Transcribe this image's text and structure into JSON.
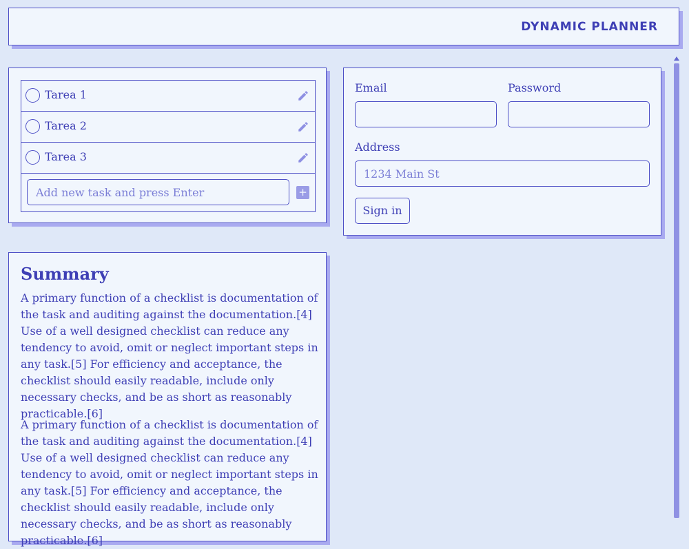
{
  "header": {
    "title": "DYNAMIC PLANNER"
  },
  "tasks": {
    "items": [
      {
        "label": "Tarea 1"
      },
      {
        "label": "Tarea 2"
      },
      {
        "label": "Tarea 3"
      }
    ],
    "new_task_placeholder": "Add new task and press Enter",
    "add_icon": "+"
  },
  "form": {
    "email_label": "Email",
    "email_value": "",
    "password_label": "Password",
    "password_value": "",
    "address_label": "Address",
    "address_placeholder": "1234 Main St",
    "address_value": "",
    "sign_in_label": "Sign in"
  },
  "summary": {
    "title": "Summary",
    "paragraphs": [
      "A primary function of a checklist is documentation of the task and auditing against the documentation.[4] Use of a well designed checklist can reduce any tendency to avoid, omit or neglect important steps in any task.[5] For efficiency and acceptance, the checklist should easily readable, include only necessary checks, and be as short as reasonably practicable.[6]",
      "A primary function of a checklist is documentation of the task and auditing against the documentation.[4] Use of a well designed checklist can reduce any tendency to avoid, omit or neglect important steps in any task.[5] For efficiency and acceptance, the checklist should easily readable, include only necessary checks, and be as short as reasonably practicable.[6]"
    ]
  },
  "colors": {
    "accent": "#3e3fb5",
    "card_bg": "#f1f6fd",
    "page_bg": "#dfe8f8",
    "shadow": "#a9aaf0"
  },
  "icons": {
    "edit": "pencil-icon",
    "checkbox": "circle-checkbox-icon",
    "add": "plus-icon"
  }
}
